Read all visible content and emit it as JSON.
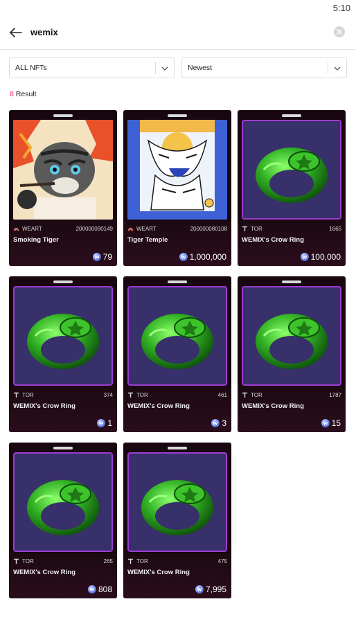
{
  "status": {
    "time": "5:10"
  },
  "search": {
    "query": "wemix"
  },
  "filters": {
    "type": "ALL NFTs",
    "sort": "Newest"
  },
  "result": {
    "count": "8",
    "label": "Result"
  },
  "colors": {
    "accent": "#e0245e",
    "card_bg": "#180710",
    "ring_frame": "#9e3bd1",
    "ring_green": "#3fbf2f"
  },
  "items": [
    {
      "art": "tiger",
      "creator": "WEART",
      "creator_icon": "weart-logo-icon",
      "token_id": "200000090149",
      "name": "Smoking Tiger",
      "price": "79"
    },
    {
      "art": "temple",
      "creator": "WEART",
      "creator_icon": "weart-logo-icon",
      "token_id": "200000080108",
      "name": "Tiger Temple",
      "price": "1,000,000"
    },
    {
      "art": "ring",
      "creator": "TOR",
      "creator_icon": "tor-logo-icon",
      "token_id": "1665",
      "name": "WEMIX's Crow Ring",
      "price": "100,000"
    },
    {
      "art": "ring",
      "creator": "TOR",
      "creator_icon": "tor-logo-icon",
      "token_id": "374",
      "name": "WEMIX's Crow Ring",
      "price": "1"
    },
    {
      "art": "ring",
      "creator": "TOR",
      "creator_icon": "tor-logo-icon",
      "token_id": "461",
      "name": "WEMIX's Crow Ring",
      "price": "3"
    },
    {
      "art": "ring",
      "creator": "TOR",
      "creator_icon": "tor-logo-icon",
      "token_id": "1787",
      "name": "WEMIX's Crow Ring",
      "price": "15"
    },
    {
      "art": "ring",
      "creator": "TOR",
      "creator_icon": "tor-logo-icon",
      "token_id": "265",
      "name": "WEMIX's Crow Ring",
      "price": "808"
    },
    {
      "art": "ring",
      "creator": "TOR",
      "creator_icon": "tor-logo-icon",
      "token_id": "475",
      "name": "WEMIX's Crow Ring",
      "price": "7,995"
    }
  ]
}
